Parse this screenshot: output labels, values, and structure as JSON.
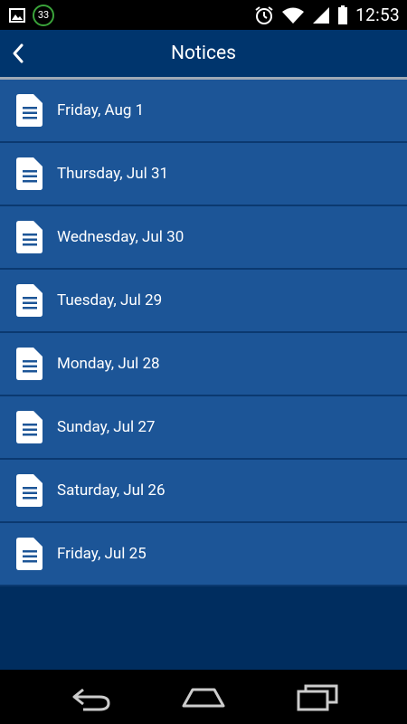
{
  "status_bar": {
    "notification_count": "33",
    "time": "12:53"
  },
  "header": {
    "title": "Notices"
  },
  "notices": [
    {
      "label": "Friday, Aug 1"
    },
    {
      "label": "Thursday, Jul 31"
    },
    {
      "label": "Wednesday, Jul 30"
    },
    {
      "label": "Tuesday, Jul 29"
    },
    {
      "label": "Monday, Jul 28"
    },
    {
      "label": "Sunday, Jul 27"
    },
    {
      "label": "Saturday, Jul 26"
    },
    {
      "label": "Friday, Jul 25"
    }
  ],
  "colors": {
    "background": "#002d5f",
    "action_bar": "#00356d",
    "list_item": "#1c5597"
  },
  "icons": {
    "item_icon": "document-icon",
    "back_icon": "chevron-left-icon"
  }
}
